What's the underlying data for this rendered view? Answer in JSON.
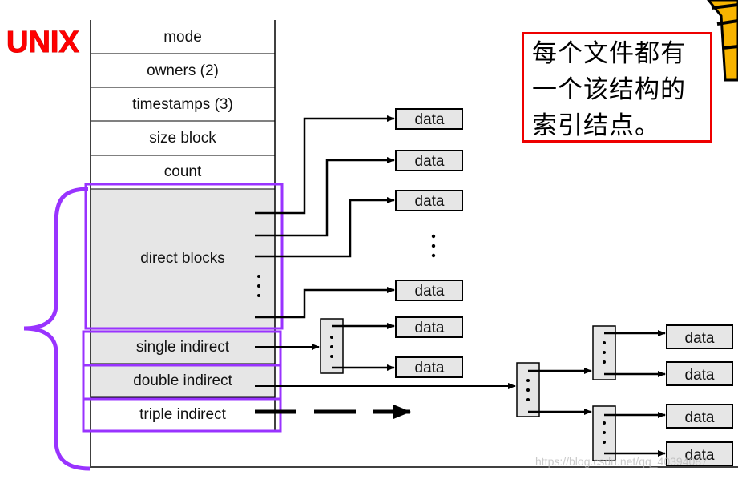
{
  "title": "UNIX",
  "inode_fields": [
    "mode",
    "owners (2)",
    "timestamps (3)",
    "size block",
    "count",
    "direct blocks",
    "single indirect",
    "double indirect",
    "triple indirect"
  ],
  "data_label": "data",
  "note": [
    "每个文件都有",
    "一个该结构的",
    "索引结点。"
  ],
  "watermark": "https://blog.csdn.net/qq_40394087",
  "colors": {
    "title": "#ff0000",
    "highlight": "#9933ff",
    "note_border": "#ee0000",
    "block_fill": "#e6e6e6"
  }
}
